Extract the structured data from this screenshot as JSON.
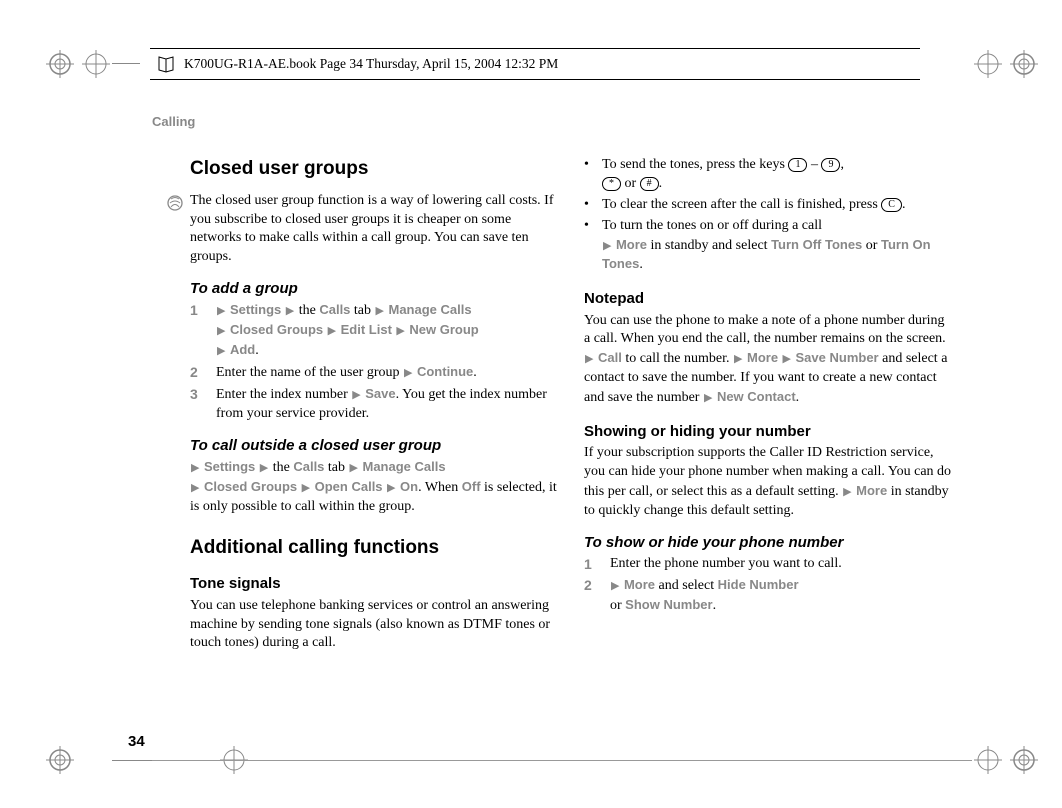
{
  "doc_header": "K700UG-R1A-AE.book  Page 34  Thursday, April 15, 2004  12:32 PM",
  "section_label": "Calling",
  "page_number": "34",
  "left": {
    "h_closed": "Closed user groups",
    "intro": "The closed user group function is a way of lowering call costs. If you subscribe to closed user groups it is cheaper on some networks to make calls within a call group. You can save ten groups.",
    "h_add": "To add a group",
    "step1_num": "1",
    "step1_pre": " ",
    "s1_settings": "Settings",
    "s1_the": " the ",
    "s1_calls": "Calls",
    "s1_tab": " tab ",
    "s1_manage": "Manage Calls",
    "s1_closed": "Closed Groups",
    "s1_edit": "Edit List",
    "s1_new": "New Group",
    "s1_add": "Add",
    "step2_num": "2",
    "step2_text_a": "Enter the name of the user group ",
    "step2_cont": "Continue",
    "step3_num": "3",
    "step3_text_a": "Enter the index number ",
    "step3_save": "Save",
    "step3_text_b": ". You get the index number from your service provider.",
    "h_call_outside": "To call outside a closed user group",
    "co_settings": "Settings",
    "co_the": " the ",
    "co_calls": "Calls",
    "co_tab": " tab ",
    "co_manage": "Manage Calls",
    "co_closed": "Closed Groups",
    "co_open": "Open Calls",
    "co_on": "On",
    "co_when": ". When ",
    "co_off": "Off",
    "co_rest": " is selected, it is only possible to call within the group.",
    "h_additional": "Additional calling functions",
    "h_tone": "Tone signals",
    "tone_text": "You can use telephone banking services or control an answering machine by sending tone signals (also known as DTMF tones or touch tones) during a call."
  },
  "right": {
    "b1_a": "To send the tones, press the keys ",
    "b1_dash": " – ",
    "b1_comma": ", ",
    "b1_or": " or ",
    "b1_end": ".",
    "key_1": "1",
    "key_9": "9",
    "key_star": "*",
    "key_hash": "#",
    "key_c": "C",
    "b2_a": "To clear the screen after the call is finished, press ",
    "b2_end": ".",
    "b3_a": "To turn the tones on or off during a call ",
    "b3_more": "More",
    "b3_b": " in standby and select ",
    "b3_off": "Turn Off Tones",
    "b3_or": " or ",
    "b3_on": "Turn On Tones",
    "b3_end": ".",
    "h_notepad": "Notepad",
    "np_a": "You can use the phone to make a note of a phone number during a call. When you end the call, the number remains on the screen. ",
    "np_call": "Call",
    "np_b": " to call the number. ",
    "np_more": "More",
    "np_save": "Save Number",
    "np_c": " and select a contact to save the number. If you want to create a new contact and save the number ",
    "np_new": "New Contact",
    "np_end": ".",
    "h_show": "Showing or hiding your number",
    "sh_a": "If your subscription supports the Caller ID Restriction service, you can hide your phone number when making a call. You can do this per call, or select this as a default setting. ",
    "sh_more": "More",
    "sh_b": " in standby to quickly change this default setting.",
    "h_show_hide": "To show or hide your phone number",
    "shs1_num": "1",
    "shs1_text": "Enter the phone number you want to call.",
    "shs2_num": "2",
    "shs2_more": "More",
    "shs2_a": " and select ",
    "shs2_hide": "Hide Number",
    "shs2_or": " or ",
    "shs2_show": "Show Number",
    "shs2_end": "."
  }
}
